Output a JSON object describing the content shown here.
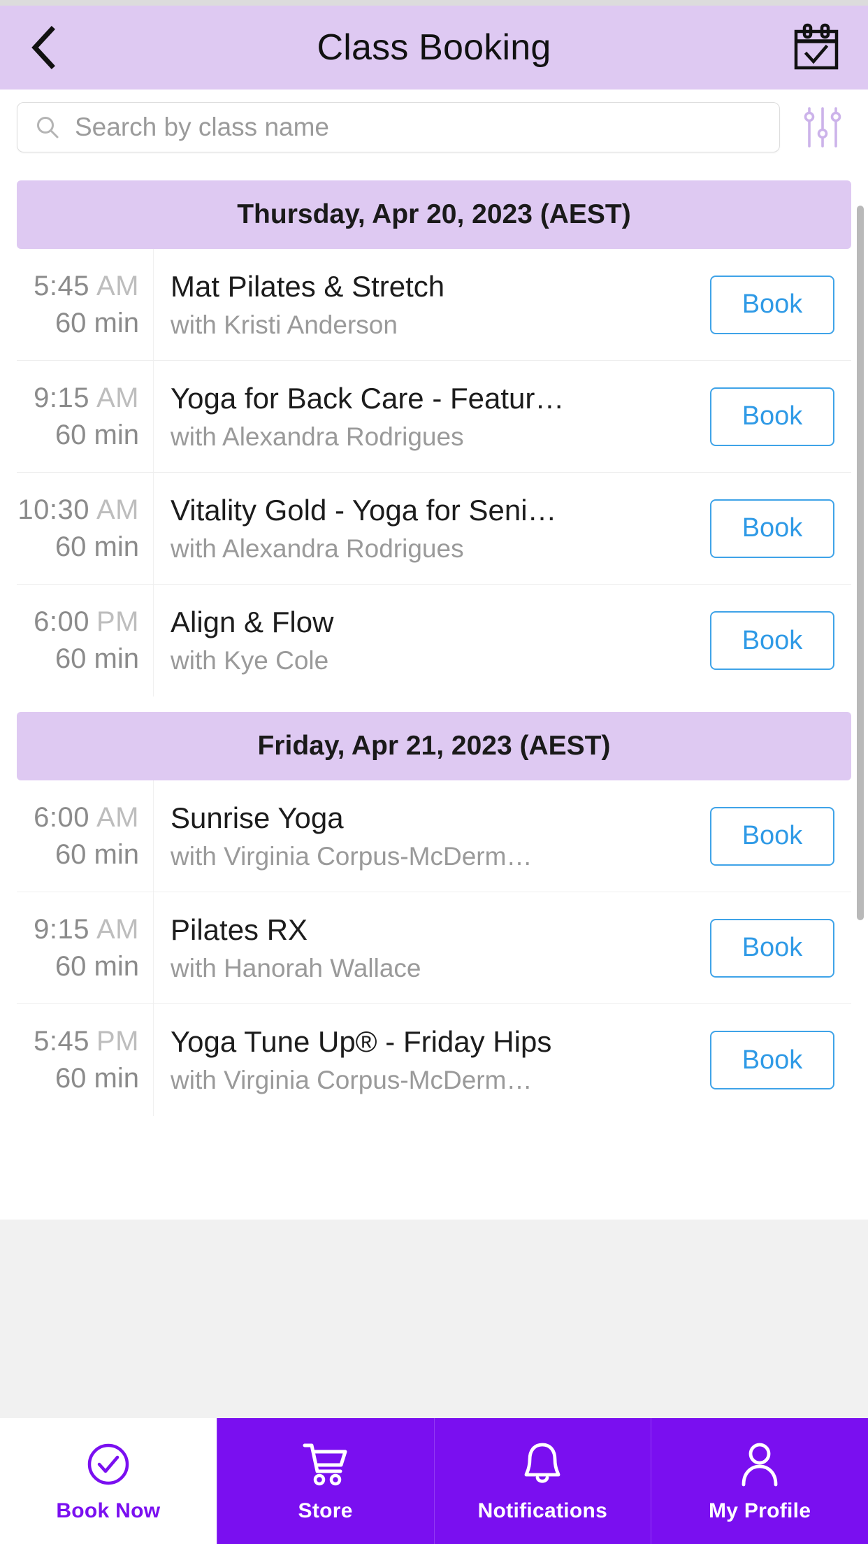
{
  "header": {
    "title": "Class Booking",
    "back_icon": "chevron-left-icon",
    "calendar_icon": "calendar-check-icon",
    "bg_color": "#DEC9F2"
  },
  "search": {
    "placeholder": "Search by class name",
    "value": "",
    "search_icon": "search-icon",
    "filter_icon": "filter-sliders-icon"
  },
  "days": [
    {
      "label": "Thursday, Apr 20, 2023 (AEST)",
      "classes": [
        {
          "time": "5:45",
          "meridiem": "AM",
          "duration": "60 min",
          "name": "Mat Pilates & Stretch",
          "instructor": "with Kristi Anderson",
          "action": "Book"
        },
        {
          "time": "9:15",
          "meridiem": "AM",
          "duration": "60 min",
          "name": "Yoga for Back Care - Featur…",
          "instructor": "with Alexandra Rodrigues",
          "action": "Book"
        },
        {
          "time": "10:30",
          "meridiem": "AM",
          "duration": "60 min",
          "name": "Vitality Gold - Yoga for Seni…",
          "instructor": "with Alexandra Rodrigues",
          "action": "Book"
        },
        {
          "time": "6:00",
          "meridiem": "PM",
          "duration": "60 min",
          "name": "Align & Flow",
          "instructor": "with Kye Cole",
          "action": "Book"
        }
      ]
    },
    {
      "label": "Friday, Apr 21, 2023 (AEST)",
      "classes": [
        {
          "time": "6:00",
          "meridiem": "AM",
          "duration": "60 min",
          "name": "Sunrise Yoga",
          "instructor": "with Virginia Corpus-McDerm…",
          "action": "Book"
        },
        {
          "time": "9:15",
          "meridiem": "AM",
          "duration": "60 min",
          "name": "Pilates RX",
          "instructor": "with Hanorah Wallace",
          "action": "Book"
        },
        {
          "time": "5:45",
          "meridiem": "PM",
          "duration": "60 min",
          "name": "Yoga Tune Up® - Friday Hips",
          "instructor": "with Virginia Corpus-McDerm…",
          "action": "Book"
        }
      ]
    }
  ],
  "bottom_nav": {
    "active_index": 0,
    "accent_color": "#7A0FF0",
    "items": [
      {
        "label": "Book Now",
        "icon": "check-circle-icon"
      },
      {
        "label": "Store",
        "icon": "shopping-cart-icon"
      },
      {
        "label": "Notifications",
        "icon": "bell-icon"
      },
      {
        "label": "My Profile",
        "icon": "user-icon"
      }
    ]
  }
}
